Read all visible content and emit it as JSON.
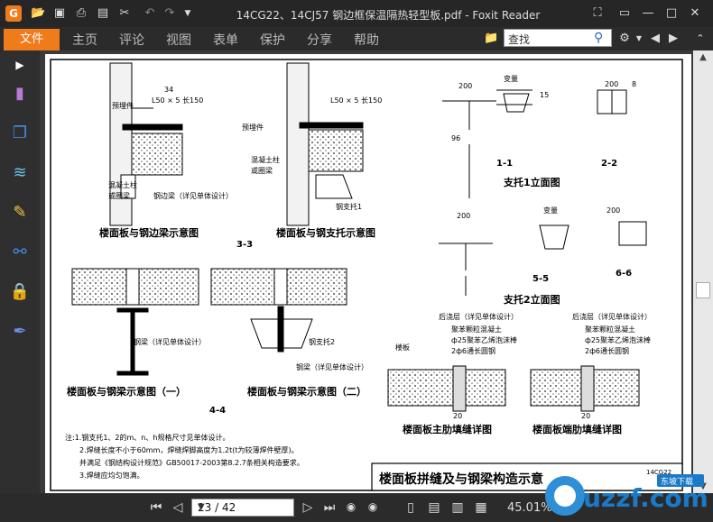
{
  "app": {
    "title": "14CG22、14CJ57 钢边框保温隔热轻型板.pdf - Foxit Reader",
    "icon_letter": "G"
  },
  "menu": {
    "file": "文件",
    "tabs": [
      "主页",
      "评论",
      "视图",
      "表单",
      "保护",
      "分享",
      "帮助"
    ]
  },
  "search": {
    "value": "查找"
  },
  "status": {
    "page": "23 / 42",
    "zoom": "45.01%"
  },
  "watermark": {
    "text": "uzzf.com",
    "sub": "东坡下载"
  },
  "drawing": {
    "top_left_caption": "楼面板与钢边梁示意图",
    "top_mid_caption": "楼面板与钢支托示意图",
    "section_33": "3-3",
    "angle_l50": "L50 × 5 长150",
    "angle_l50_b": "L50 × 5 长150",
    "dim_34": "34",
    "embedded": "预埋件",
    "embedded_b": "预埋件",
    "concrete_col": "混凝土柱",
    "or_beam": "或圈梁",
    "concrete_col_b": "混凝土柱",
    "or_beam_b": "或圈梁",
    "steel_edge_beam": "钢边梁（详见单体设计）",
    "steel_support1": "钢支托1",
    "support1_title": "支托1立面图",
    "support2_title": "支托2立面图",
    "sec_11": "1-1",
    "sec_22": "2-2",
    "sec_55": "5-5",
    "sec_66": "6-6",
    "dim_200": "200",
    "variable": "变量",
    "dim_96": "96",
    "dim_15": "15",
    "dim_8": "8",
    "beam1_caption": "楼面板与钢梁示意图（一）",
    "beam2_caption": "楼面板与钢梁示意图（二）",
    "steel_beam": "钢梁（详见单体设计）",
    "steel_beam_b": "钢梁（详见单体设计）",
    "steel_support2": "钢支托2",
    "section_44": "4-4",
    "post_layer": "后浇层（详见单体设计）",
    "poly_concrete": "聚苯颗粒混凝土",
    "foam_rod": "ф25聚苯乙烯泡沫棒",
    "rebar": "2ф6通长圆钢",
    "post_layer_b": "后浇层（详见单体设计）",
    "poly_concrete_b": "聚苯颗粒混凝土",
    "foam_rod_b": "ф25聚苯乙烯泡沫棒",
    "rebar_b": "2ф6通长圆钢",
    "floor_plate": "楼板",
    "dim_20": "20",
    "main_rib_caption": "楼面板主肋填缝详图",
    "end_rib_caption": "楼面板端肋填缝详图",
    "note1": "注:1.钢支托1、2的m、n、h规格尺寸见单体设计。",
    "note2": "2.焊缝长度不小于60mm，焊缝焊脚高度为1.2t(t为较薄焊件壁厚)。",
    "note3": "并满足《钢结构设计规范》GB50017-2003第8.2.7条相关构造要求。",
    "note4": "3.焊缝应均匀饱满。",
    "frame_title": "楼面板拼缝及与钢梁构造示意",
    "code": "14CG22"
  },
  "colors": {
    "accent": "#f07b1b",
    "titlebar": "#262626",
    "toolbar": "#2f2f2f"
  }
}
